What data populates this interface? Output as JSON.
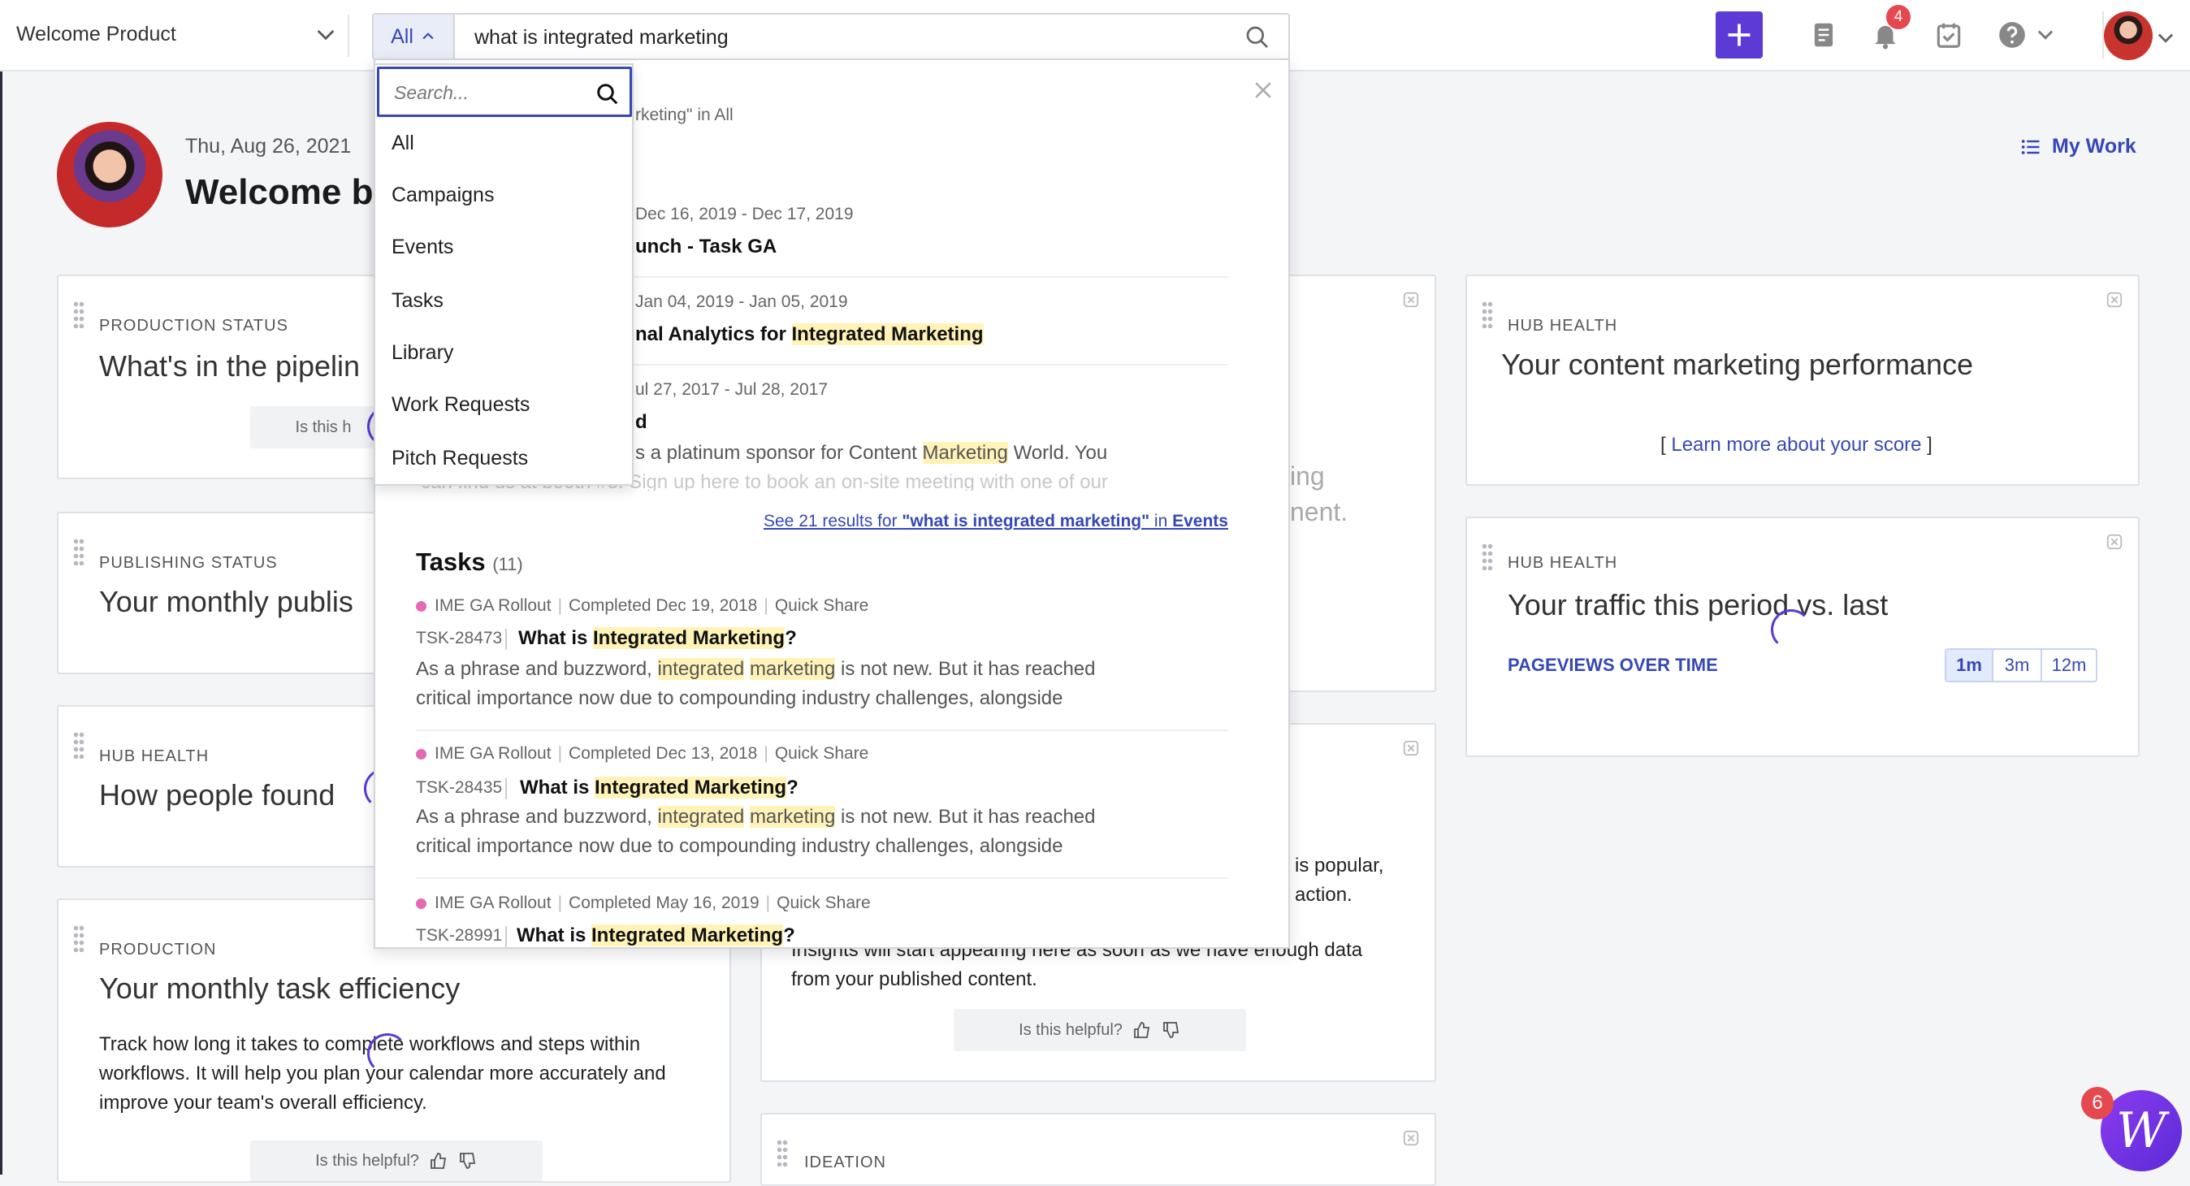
{
  "topbar": {
    "workspace": "Welcome Product",
    "scope_label": "All",
    "search_query": "what is integrated marketing",
    "notifications_count": "4"
  },
  "welcome": {
    "date": "Thu, Aug 26, 2021",
    "title": "Welcome b",
    "my_work": "My Work"
  },
  "cards": {
    "production_status": {
      "eyebrow": "PRODUCTION STATUS",
      "title": "What's in the pipelin",
      "helpful": "Is this h"
    },
    "publishing_status": {
      "eyebrow": "PUBLISHING STATUS",
      "title": "Your monthly publis"
    },
    "hub_health_people": {
      "eyebrow": "HUB HEALTH",
      "title": "How people found"
    },
    "production": {
      "eyebrow": "PRODUCTION",
      "title": "Your monthly task efficiency",
      "body": "Track how long it takes to complete workflows and steps within workflows. It will help you plan your calendar more accurately and improve your team's overall efficiency.",
      "helpful": "Is this helpful?"
    },
    "hub_content": {
      "eyebrow": "HUB HEALTH",
      "title": "Your content marketing performance",
      "link": "Learn more about your score"
    },
    "hub_traffic": {
      "eyebrow": "HUB HEALTH",
      "title": "Your traffic this period vs. last",
      "subtitle": "PAGEVIEWS OVER TIME",
      "ranges": [
        "1m",
        "3m",
        "12m"
      ]
    },
    "middle_partial": {
      "line1": "ing",
      "line2": "nent."
    },
    "insights": {
      "line1": "is popular,",
      "line2": "action.",
      "line3": "Insights will start appearing here as soon as we have enough data",
      "line4": "from your published content.",
      "helpful": "Is this helpful?"
    },
    "ideation": {
      "eyebrow": "IDEATION"
    }
  },
  "scope_menu": {
    "placeholder": "Search...",
    "items": [
      "All",
      "Campaigns",
      "Events",
      "Tasks",
      "Library",
      "Work Requests",
      "Pitch Requests"
    ]
  },
  "results": {
    "header_fragment": "rketing\" in All",
    "events": [
      {
        "date": "Dec 16, 2019 - Dec 17, 2019",
        "title": "unch - Task GA"
      },
      {
        "date": "Jan 04, 2019 - Jan 05, 2019",
        "title_pre": "nal Analytics for ",
        "title_hl": "Integrated Marketing"
      },
      {
        "date": "ul 27, 2017 - Jul 28, 2017",
        "title": "d",
        "desc_pre": "s a platinum sponsor for Content ",
        "desc_hl": "Marketing",
        "desc_post": " World. You",
        "desc_line2": "can find us at booth #3. Sign up here to book an on-site meeting with one of our"
      }
    ],
    "see_more": {
      "prefix": "See 21 results for ",
      "query": "\"what is integrated marketing\"",
      "mid": " in ",
      "scope": "Events"
    },
    "tasks_heading": "Tasks",
    "tasks_count": "(11)",
    "tasks": [
      {
        "campaign": "IME GA Rollout",
        "status": "Completed Dec 19, 2018",
        "type": "Quick Share",
        "id": "TSK-28473",
        "title_pre": "What is ",
        "title_hl": "Integrated Marketing",
        "title_post": "?",
        "desc_pre": "As a phrase and buzzword, ",
        "desc_hl1": "integrated",
        "desc_hl2": "marketing",
        "desc_post": " is not new. But it has reached",
        "desc_line2": "critical importance now due to compounding industry challenges, alongside"
      },
      {
        "campaign": "IME GA Rollout",
        "status": "Completed Dec 13, 2018",
        "type": "Quick Share",
        "id": "TSK-28435",
        "title_pre": "What is ",
        "title_hl": "Integrated Marketing",
        "title_post": "?",
        "desc_pre": "As a phrase and buzzword, ",
        "desc_hl1": "integrated",
        "desc_hl2": "marketing",
        "desc_post": " is not new. But it has reached",
        "desc_line2": "critical importance now due to compounding industry challenges, alongside"
      },
      {
        "campaign": "IME GA Rollout",
        "status": "Completed May 16, 2019",
        "type": "Quick Share",
        "id": "TSK-28991",
        "title_pre": "What is ",
        "title_hl": "Integrated Marketing",
        "title_post": "?"
      }
    ]
  },
  "widget": {
    "badge": "6",
    "glyph": "W"
  },
  "colors": {
    "accent": "#5b3ad6",
    "link": "#3548b5",
    "highlight": "#fff3b8",
    "badge": "#e5484d"
  }
}
